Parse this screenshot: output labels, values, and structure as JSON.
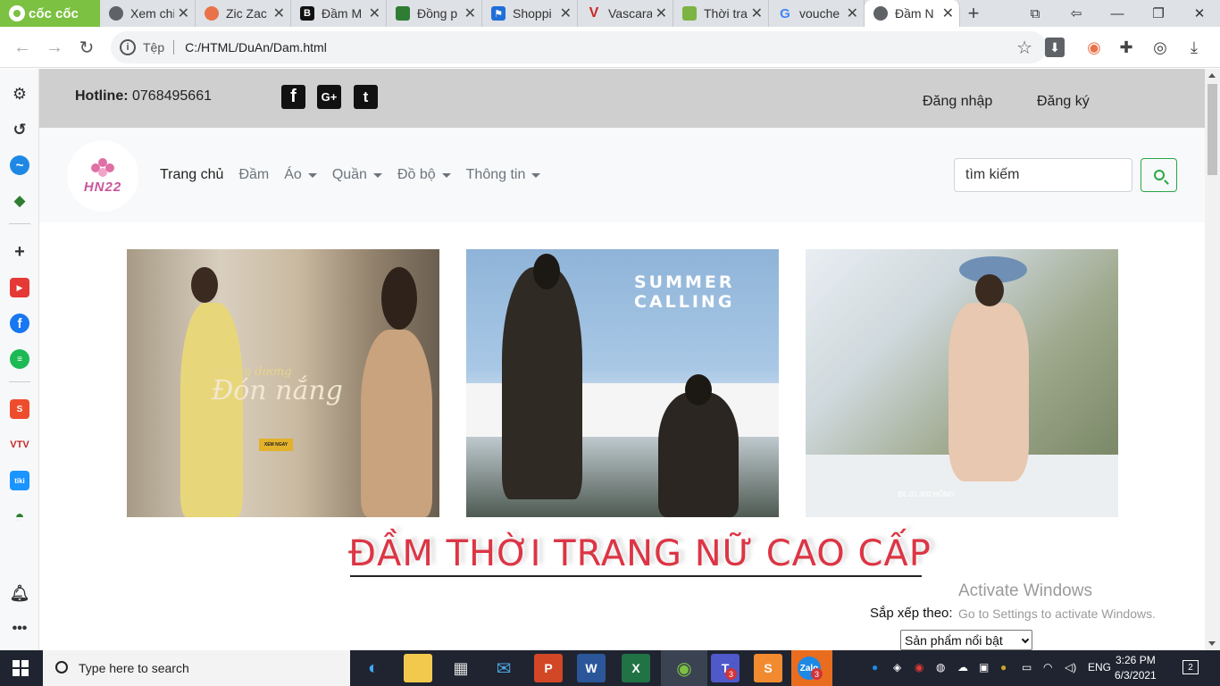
{
  "browser": {
    "brand": "cốc cốc",
    "tabs": [
      {
        "label": "Xem chi",
        "icon": "globe-icon",
        "color": "#5f6368"
      },
      {
        "label": "Zic Zac",
        "icon": "zic-zac-icon",
        "color": "#e8734a"
      },
      {
        "label": "Đầm M",
        "icon": "b-letter-icon",
        "color": "#111111"
      },
      {
        "label": "Đồng p",
        "icon": "store-icon",
        "color": "#2e7d32"
      },
      {
        "label": "Shoppi",
        "icon": "flag-icon",
        "color": "#1e6fd9"
      },
      {
        "label": "Vascara",
        "icon": "v-letter-icon",
        "color": "#c62828"
      },
      {
        "label": "Thời tra",
        "icon": "shop-bag-icon",
        "color": "#7cb342"
      },
      {
        "label": "vouche",
        "icon": "google-icon",
        "color": "#4285f4"
      },
      {
        "label": "Đầm N",
        "icon": "globe-icon",
        "color": "#5f6368"
      }
    ],
    "address": {
      "scheme_label": "Tệp",
      "url": "C:/HTML/DuAn/Dam.html"
    }
  },
  "site": {
    "hotline_label": "Hotline:",
    "hotline_number": "0768495661",
    "social": [
      {
        "name": "facebook-icon",
        "glyph": "f"
      },
      {
        "name": "google-plus-icon",
        "glyph": "G+"
      },
      {
        "name": "twitter-icon",
        "glyph": "t"
      }
    ],
    "login": "Đăng nhập",
    "register": "Đăng ký",
    "logo_text": "HN22",
    "menu": [
      {
        "label": "Trang chủ",
        "dropdown": false
      },
      {
        "label": "Đầm",
        "dropdown": false
      },
      {
        "label": "Áo",
        "dropdown": true
      },
      {
        "label": "Quần",
        "dropdown": true
      },
      {
        "label": "Đồ bộ",
        "dropdown": true
      },
      {
        "label": "Thông tin",
        "dropdown": true
      }
    ],
    "search_placeholder": "tìm kiếm",
    "banners": {
      "b1_small": "Hương dương",
      "b1_big": "Đón nắng",
      "b1_button": "XEM NGAY",
      "b2_line1": "SUMMER",
      "b2_line2": "CALLING",
      "b3_caption": "ĐL 01.300 HỒNG"
    },
    "heading": "ĐẦM THỜI TRANG NỮ CAO CẤP",
    "sort_label": "Sắp xếp theo:",
    "sort_selected": "Sản phẩm nổi bật"
  },
  "watermark": {
    "line1": "Activate Windows",
    "line2": "Go to Settings to activate Windows."
  },
  "taskbar": {
    "search_placeholder": "Type here to search",
    "language": "ENG",
    "time": "3:26 PM",
    "date": "6/3/2021",
    "notifications": "2",
    "badges": {
      "teams": "3",
      "zalo": "3"
    }
  }
}
